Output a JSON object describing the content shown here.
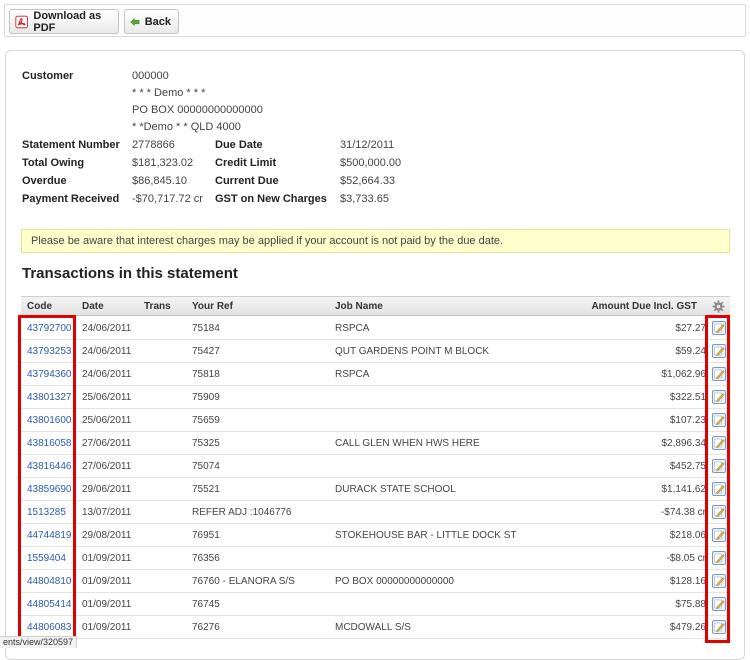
{
  "toolbar": {
    "pdf_label": "Download as PDF",
    "back_label": "Back"
  },
  "customer": {
    "label": "Customer",
    "lines": [
      "000000",
      "* * * Demo * * *",
      "PO BOX 00000000000000",
      "* *Demo * * QLD 4000"
    ]
  },
  "summary": {
    "statement_number_label": "Statement Number",
    "statement_number": "2778866",
    "due_date_label": "Due Date",
    "due_date": "31/12/2011",
    "total_owing_label": "Total Owing",
    "total_owing": "$181,323.02",
    "credit_limit_label": "Credit Limit",
    "credit_limit": "$500,000.00",
    "overdue_label": "Overdue",
    "overdue": "$86,845.10",
    "current_due_label": "Current Due",
    "current_due": "$52,664.33",
    "payment_received_label": "Payment Received",
    "payment_received": "-$70,717.72 cr",
    "gst_label": "GST on New Charges",
    "gst": "$3,733.65"
  },
  "notice": "Please be aware that interest charges may be applied if your account is not paid by the due date.",
  "transactions": {
    "title": "Transactions in this statement",
    "columns": {
      "code": "Code",
      "date": "Date",
      "trans": "Trans",
      "your_ref": "Your Ref",
      "job_name": "Job Name",
      "amount": "Amount Due Incl. GST"
    },
    "rows": [
      {
        "code": "43792700",
        "date": "24/06/2011",
        "ref": "75184",
        "job": "RSPCA",
        "amount": "$27.27"
      },
      {
        "code": "43793253",
        "date": "24/06/2011",
        "ref": "75427",
        "job": "QUT GARDENS POINT M BLOCK",
        "amount": "$59.24"
      },
      {
        "code": "43794360",
        "date": "24/06/2011",
        "ref": "75818",
        "job": "RSPCA",
        "amount": "$1,062.96"
      },
      {
        "code": "43801327",
        "date": "25/06/2011",
        "ref": "75909",
        "job": "",
        "amount": "$322.51"
      },
      {
        "code": "43801600",
        "date": "25/06/2011",
        "ref": "75659",
        "job": "",
        "amount": "$107.23"
      },
      {
        "code": "43816058",
        "date": "27/06/2011",
        "ref": "75325",
        "job": "CALL GLEN WHEN HWS HERE",
        "amount": "$2,896.34"
      },
      {
        "code": "43816446",
        "date": "27/06/2011",
        "ref": "75074",
        "job": "",
        "amount": "$452.75"
      },
      {
        "code": "43859690",
        "date": "29/06/2011",
        "ref": "75521",
        "job": "DURACK STATE SCHOOL",
        "amount": "$1,141.62"
      },
      {
        "code": "1513285",
        "date": "13/07/2011",
        "ref": "REFER ADJ :1046776",
        "job": "",
        "amount": "-$74.38 cr"
      },
      {
        "code": "44744819",
        "date": "29/08/2011",
        "ref": "76951",
        "job": "STOKEHOUSE BAR - LITTLE DOCK ST",
        "amount": "$218.06"
      },
      {
        "code": "1559404",
        "date": "01/09/2011",
        "ref": "76356",
        "job": "",
        "amount": "-$8.05 cr"
      },
      {
        "code": "44804810",
        "date": "01/09/2011",
        "ref": "76760 - ELANORA S/S",
        "job": "PO BOX 00000000000000",
        "amount": "$128.16"
      },
      {
        "code": "44805414",
        "date": "01/09/2011",
        "ref": "76745",
        "job": "",
        "amount": "$75.88"
      },
      {
        "code": "44806083",
        "date": "01/09/2011",
        "ref": "76276",
        "job": "MCDOWALL S/S",
        "amount": "$479.26"
      }
    ]
  },
  "status_url": "ents/view/320597",
  "colors": {
    "link": "#2a5db0",
    "notice_bg": "#ffffcc",
    "highlight": "#e00000"
  },
  "icons": {
    "pdf": "pdf-icon",
    "back": "back-arrow-icon",
    "gear": "gear-icon",
    "edit": "edit-note-icon"
  }
}
